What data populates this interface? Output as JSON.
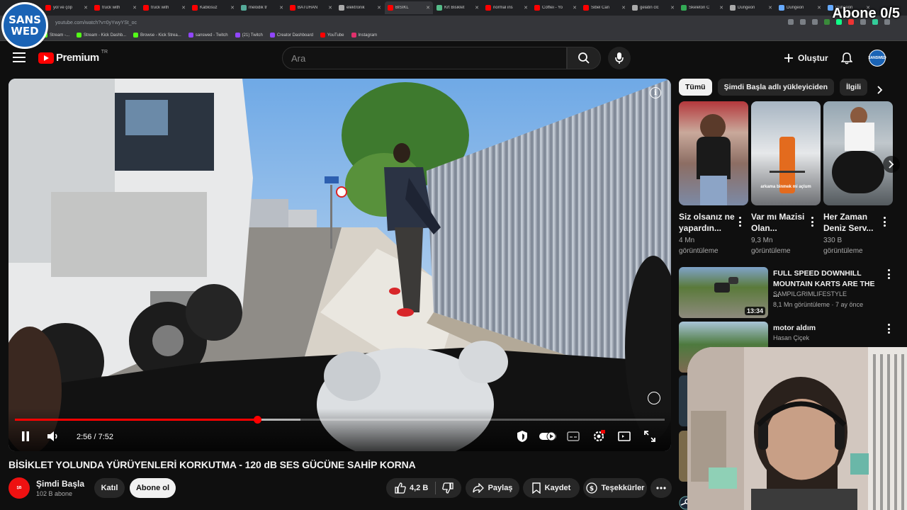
{
  "browser": {
    "tabs": [
      {
        "label": "yol ve çöp",
        "color": "#ff0000",
        "active": false
      },
      {
        "label": "truck with",
        "color": "#ff0000",
        "active": false
      },
      {
        "label": "truck with",
        "color": "#ff0000",
        "active": false
      },
      {
        "label": "Kablosuz",
        "color": "#ff0000",
        "active": false
      },
      {
        "label": "melodik tr",
        "color": "#5a9",
        "active": false
      },
      {
        "label": "BATUHAN",
        "color": "#ff0000",
        "active": false
      },
      {
        "label": "elektronik",
        "color": "#aaa",
        "active": false
      },
      {
        "label": "BİSİKL",
        "color": "#ff0000",
        "active": true
      },
      {
        "label": "Krt Bisiklet",
        "color": "#5b8",
        "active": false
      },
      {
        "label": "normal ins",
        "color": "#ff0000",
        "active": false
      },
      {
        "label": "Coffiei - Yo",
        "color": "#ff0000",
        "active": false
      },
      {
        "label": "Sibel Can",
        "color": "#ff0000",
        "active": false
      },
      {
        "label": "gelatin clc",
        "color": "#aaa",
        "active": false
      },
      {
        "label": "Skeleton C",
        "color": "#3a5",
        "active": false
      },
      {
        "label": "Dungeon",
        "color": "#aaa",
        "active": false
      },
      {
        "label": "Dungeon",
        "color": "#6af",
        "active": false
      },
      {
        "label": "Dungeon",
        "color": "#6af",
        "active": false
      }
    ],
    "url": "youtube.com/watch?v=0yYwyYSt_oc",
    "bookmarks": [
      {
        "label": "Stream -...",
        "color": "#53fc18"
      },
      {
        "label": "Stream - Kick Dashb...",
        "color": "#53fc18"
      },
      {
        "label": "Browse - Kick Strea...",
        "color": "#53fc18"
      },
      {
        "label": "sanswed - Twitch",
        "color": "#9146ff"
      },
      {
        "label": "(21) Twitch",
        "color": "#9146ff"
      },
      {
        "label": "Creator Dashboard",
        "color": "#9146ff"
      },
      {
        "label": "YouTube",
        "color": "#ff0000"
      },
      {
        "label": "Instagram",
        "color": "#e1306c"
      }
    ]
  },
  "overlay": {
    "logo_line1": "SANS",
    "logo_line2": "WED",
    "goal": "Abone 0/5"
  },
  "header": {
    "brand": "Premium",
    "country": "TR",
    "search_placeholder": "Ara",
    "create_label": "Oluştur",
    "avatar_line1": "SANS",
    "avatar_line2": "WED"
  },
  "player": {
    "current_time": "2:56",
    "duration": "7:52",
    "progress_fraction": 0.373,
    "buffer_fraction": 0.44
  },
  "video": {
    "title": "BİSİKLET YOLUNDA YÜRÜYENLERİ KORKUTMA - 120 dB SES GÜCÜNE SAHİP KORNA",
    "channel": "Şimdi Başla",
    "subscribers": "102 B abone",
    "join_label": "Katıl",
    "subscribe_label": "Abone ol",
    "likes": "4,2 B",
    "share_label": "Paylaş",
    "save_label": "Kaydet",
    "thanks_label": "Teşekkürler"
  },
  "chips": [
    "Tümü",
    "Şimdi Başla adlı yükleyiciden",
    "İlgili"
  ],
  "shorts": [
    {
      "title": "Siz olsanız ne yapardın...",
      "views": "4 Mn görüntüleme"
    },
    {
      "title": "Var mı Mazisi Olan...",
      "views": "9,3 Mn görüntüleme",
      "caption": "arkama binmek mi açlum"
    },
    {
      "title": "Her Zaman Deniz Serv...",
      "views": "330 B görüntüleme"
    }
  ],
  "recommendations": [
    {
      "title": "FULL SPEED DOWNHILL MOUNTAIN KARTS ARE THE ...",
      "channel": "SAMPILGRIMLIFESTYLE",
      "meta": "8,1 Mn görüntüleme · 7 ay önce",
      "duration": "13:34"
    },
    {
      "title": "motor aldım",
      "channel": "Hasan Çiçek",
      "meta": "",
      "duration": ""
    }
  ]
}
